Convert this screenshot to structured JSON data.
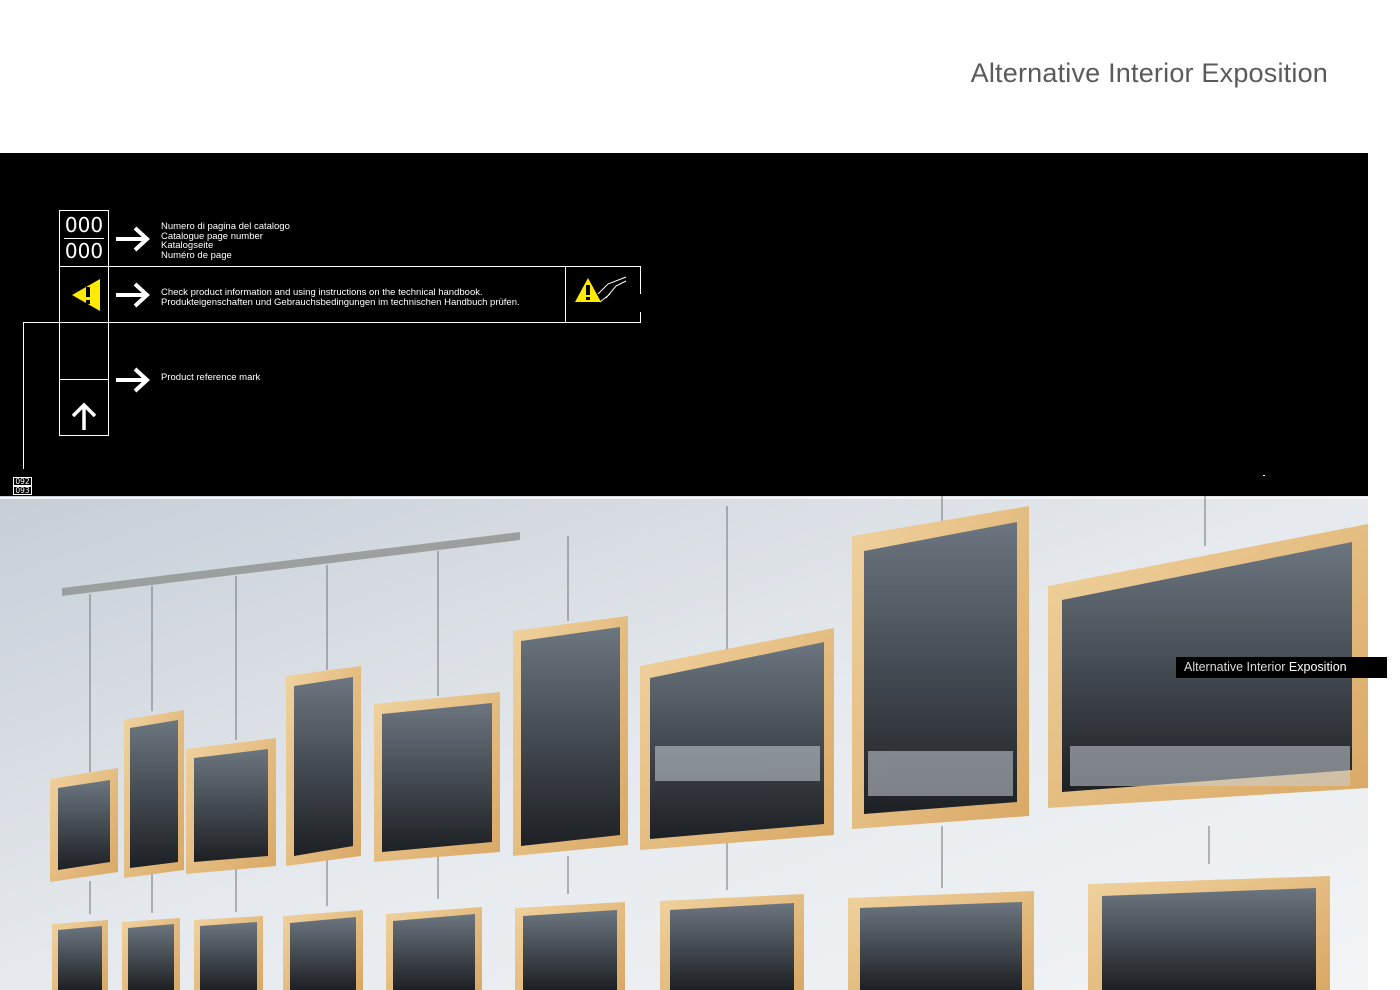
{
  "header": {
    "title": "Alternative Interior Exposition"
  },
  "legend": {
    "page_number_top": "000",
    "page_number_bottom": "000",
    "page_number_desc": [
      "Numero di pagina del catalogo",
      "Catalogue page number",
      "Katalogseite",
      "Numéro de page"
    ],
    "warning_desc": [
      "Check product information and using instructions on the technical handbook.",
      "Produkteigenschaften und Gebrauchsbedingungen im technischen Handbuch prüfen."
    ],
    "reference_desc": "Product reference mark"
  },
  "side_strip": {
    "page_a": "092",
    "page_b": "093",
    "code": "00"
  },
  "caption": {
    "part1": "Alternative Interior",
    "part2": "Exposition"
  },
  "colors": {
    "accent_yellow": "#ffeb00",
    "frame_wood": "#e8c48a",
    "wall": "#e4e8ec"
  }
}
